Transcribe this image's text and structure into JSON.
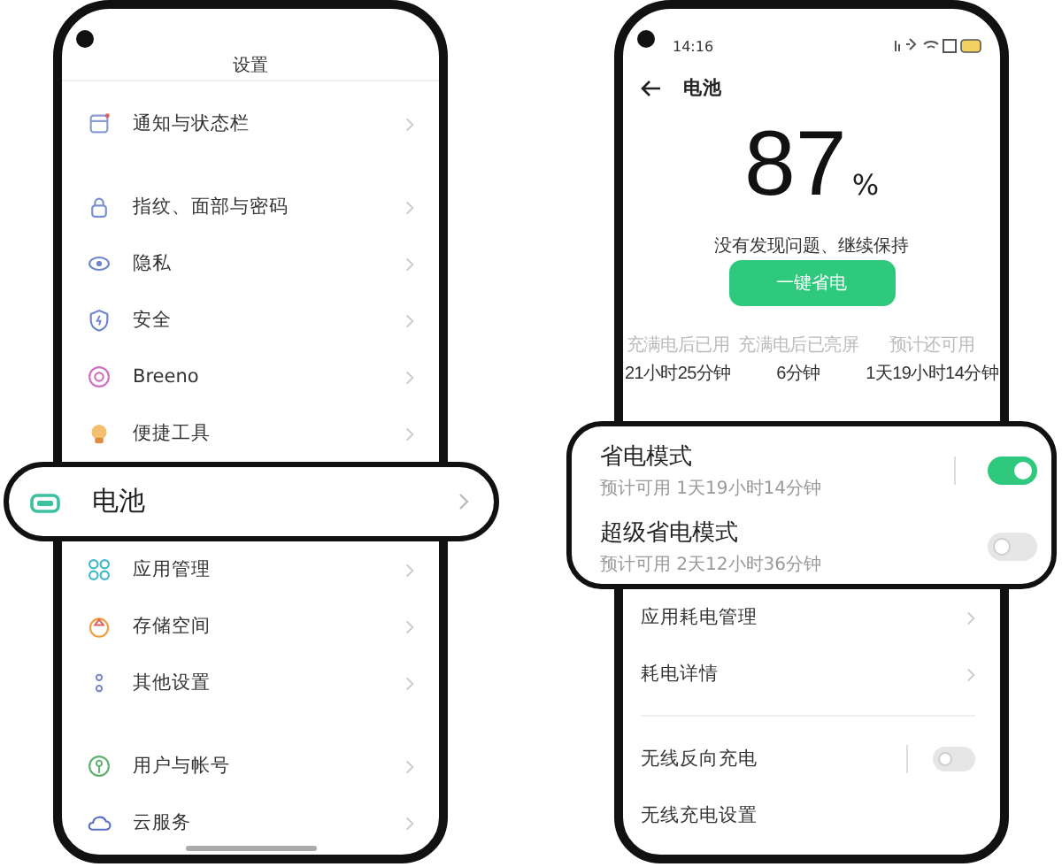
{
  "settings": {
    "title": "设置",
    "sections": [
      [
        {
          "label": "通知与状态栏",
          "kind": "row"
        }
      ],
      [
        {
          "label": "指纹、面部与密码",
          "kind": "row"
        },
        {
          "label": "隐私",
          "kind": "row"
        },
        {
          "label": "安全",
          "kind": "row"
        },
        {
          "label": "Breeno",
          "kind": "row"
        },
        {
          "label": "便捷工具",
          "kind": "row"
        },
        {
          "label": "电池",
          "kind": "highlight"
        },
        {
          "label": "应用管理",
          "kind": "row"
        },
        {
          "label": "存储空间",
          "kind": "row"
        },
        {
          "label": "其他设置",
          "kind": "row"
        }
      ],
      [
        {
          "label": "用户与帐号",
          "kind": "row"
        },
        {
          "label": "云服务",
          "kind": "row"
        }
      ]
    ]
  },
  "battery": {
    "status_time": "14:16",
    "title": "电池",
    "percent": "87",
    "percent_sign": "%",
    "message": "没有发现问题、继续保持",
    "action_button": "一键省电",
    "stats": [
      {
        "label": "充满电后已用",
        "value": "21小时25分钟"
      },
      {
        "label": "充满电后已亮屏",
        "value": "6分钟"
      },
      {
        "label": "预计还可用",
        "value": "1天19小时14分钟"
      }
    ],
    "modes": [
      {
        "title": "省电模式",
        "subtitle": "预计可用 1天19小时14分钟",
        "on": true
      },
      {
        "title": "超级省电模式",
        "subtitle": "预计可用 2天12小时36分钟",
        "on": false
      }
    ],
    "sections": [
      [
        {
          "label": "应用耗电管理",
          "kind": "link"
        },
        {
          "label": "耗电详情",
          "kind": "link"
        }
      ],
      [
        {
          "label": "无线反向充电",
          "kind": "toggle",
          "on": false
        },
        {
          "label": "无线充电设置",
          "kind": "label"
        }
      ]
    ]
  }
}
